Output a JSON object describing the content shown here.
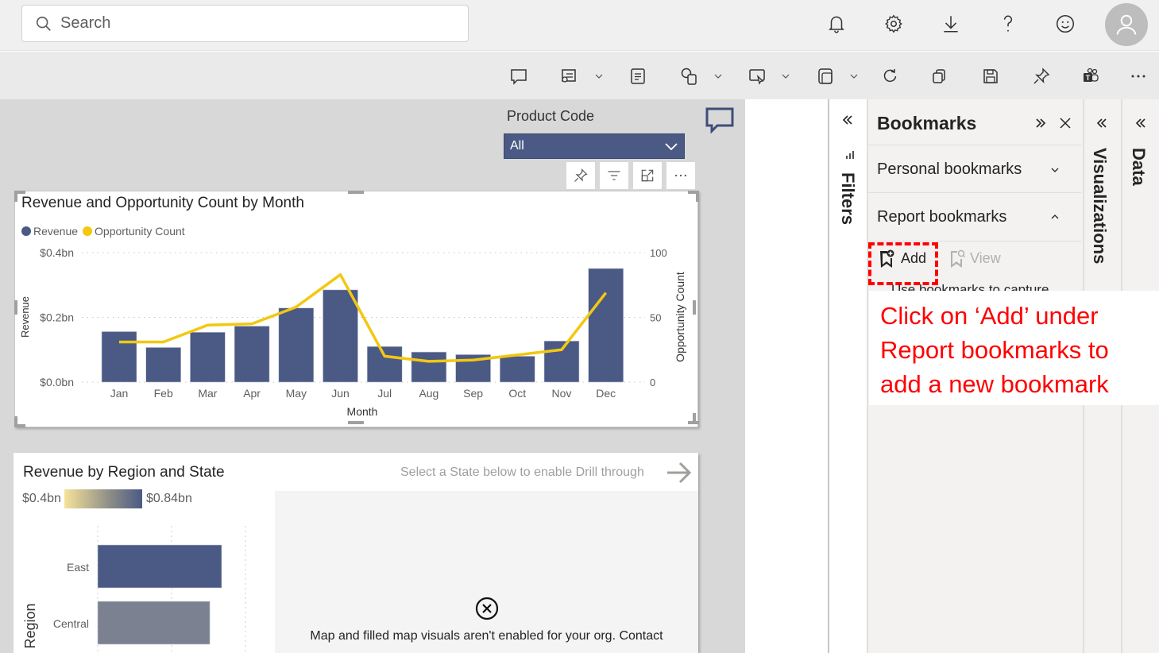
{
  "header": {
    "search_placeholder": "Search",
    "icons": [
      "bell-icon",
      "gear-icon",
      "download-icon",
      "help-icon",
      "feedback-smiley-icon",
      "avatar-icon"
    ]
  },
  "toolbar": {
    "icons": [
      "comment-icon",
      "subscribe-icon",
      "notes-icon",
      "shapes-icon",
      "present-icon",
      "view-icon",
      "refresh-icon",
      "duplicate-icon",
      "save-icon",
      "pin-icon",
      "teams-icon",
      "more-icon"
    ]
  },
  "slicer": {
    "label": "Product Code",
    "value": "All"
  },
  "visual_header": {
    "icons": [
      "pin-visual-icon",
      "filter-icon",
      "focus-mode-icon",
      "more-options-icon"
    ]
  },
  "chart1": {
    "title": "Revenue and Opportunity Count by Month",
    "legend": [
      {
        "label": "Revenue",
        "color": "#4a5a85"
      },
      {
        "label": "Opportunity Count",
        "color": "#f2c811"
      }
    ],
    "y_left_label": "Revenue",
    "y_right_label": "Opportunity Count",
    "x_label": "Month"
  },
  "chart_data": [
    {
      "type": "bar+line",
      "title": "Revenue and Opportunity Count by Month",
      "categories": [
        "Jan",
        "Feb",
        "Mar",
        "Apr",
        "May",
        "Jun",
        "Jul",
        "Aug",
        "Sep",
        "Oct",
        "Nov",
        "Dec"
      ],
      "series": [
        {
          "name": "Revenue",
          "type": "bar",
          "axis": "left",
          "unit": "bn",
          "values": [
            0.156,
            0.107,
            0.154,
            0.173,
            0.229,
            0.285,
            0.11,
            0.093,
            0.085,
            0.08,
            0.127,
            0.351
          ],
          "color": "#4a5a85"
        },
        {
          "name": "Opportunity Count",
          "type": "line",
          "axis": "right",
          "values": [
            31,
            31,
            44,
            45,
            58,
            83,
            20,
            16,
            17,
            21,
            25,
            69
          ],
          "color": "#f2c811"
        }
      ],
      "xlabel": "Month",
      "ylabel": "Revenue",
      "y2label": "Opportunity Count",
      "ylim": [
        0,
        0.4
      ],
      "y2lim": [
        0,
        100
      ],
      "yticks": [
        "$0.0bn",
        "$0.2bn",
        "$0.4bn"
      ],
      "y2ticks": [
        "0",
        "50",
        "100"
      ],
      "grid": true,
      "legend_position": "top-left"
    },
    {
      "type": "bar",
      "orientation": "horizontal",
      "title": "Revenue by Region and State",
      "categories": [
        "East",
        "Central"
      ],
      "values": [
        0.84,
        0.76
      ],
      "colors": [
        "#4a5a85",
        "#7b8190"
      ],
      "ylabel": "Region",
      "color_scale": {
        "min_label": "$0.4bn",
        "max_label": "$0.84bn"
      }
    }
  ],
  "chart2": {
    "title": "Revenue by Region and State",
    "scale_min": "$0.4bn",
    "scale_max": "$0.84bn",
    "y_label": "Region",
    "drill_hint": "Select a State below to enable Drill through",
    "map_error": "Map and filled map visuals aren't enabled for your org. Contact"
  },
  "panes": {
    "filters_label": "Filters",
    "visualizations_label": "Visualizations",
    "data_label": "Data"
  },
  "bookmarks": {
    "title": "Bookmarks",
    "personal_label": "Personal bookmarks",
    "report_label": "Report bookmarks",
    "add_label": "Add",
    "view_label": "View",
    "hint_text": "Use bookmarks to capture"
  },
  "callout": {
    "lines": [
      "Click on ‘Add’ under",
      "Report bookmarks to",
      "add a new bookmark"
    ],
    "color": "#ff0000"
  }
}
